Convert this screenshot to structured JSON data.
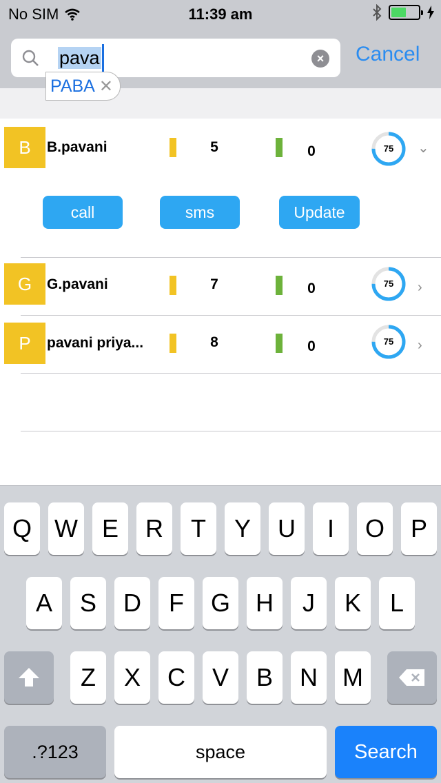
{
  "status_bar": {
    "carrier": "No SIM",
    "time": "11:39 am"
  },
  "search": {
    "query": "pava",
    "cancel_label": "Cancel",
    "autocorrect_suggestion": "PABA"
  },
  "contacts": [
    {
      "initial": "B",
      "name": "B.pavani",
      "count_yellow": "5",
      "count_green": "0",
      "progress": "75",
      "expanded": true
    },
    {
      "initial": "G",
      "name": "G.pavani",
      "count_yellow": "7",
      "count_green": "0",
      "progress": "75",
      "expanded": false
    },
    {
      "initial": "P",
      "name": "pavani priya...",
      "count_yellow": "8",
      "count_green": "0",
      "progress": "75",
      "expanded": false
    }
  ],
  "actions": {
    "call": "call",
    "sms": "sms",
    "update": "Update"
  },
  "keyboard": {
    "row1": [
      "Q",
      "W",
      "E",
      "R",
      "T",
      "Y",
      "U",
      "I",
      "O",
      "P"
    ],
    "row2": [
      "A",
      "S",
      "D",
      "F",
      "G",
      "H",
      "J",
      "K",
      "L"
    ],
    "row3": [
      "Z",
      "X",
      "C",
      "V",
      "B",
      "N",
      "M"
    ],
    "numbers_label": ".?123",
    "space_label": "space",
    "search_label": "Search"
  },
  "colors": {
    "accent": "#2ea7f2",
    "avatar": "#f2c324",
    "bar_yellow": "#f2c324",
    "bar_green": "#6db23b",
    "search_key": "#1a82fb"
  }
}
